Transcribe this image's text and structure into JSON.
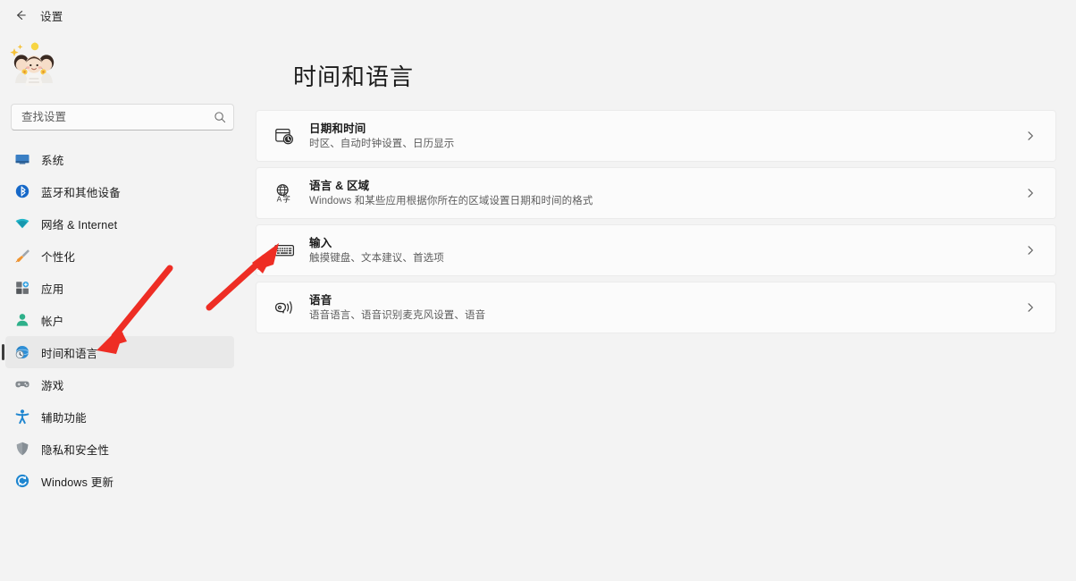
{
  "window": {
    "title": "设置",
    "back_icon": "back-arrow-icon"
  },
  "sidebar": {
    "avatar": "user-avatar",
    "search": {
      "placeholder": "查找设置",
      "value": "",
      "icon": "search-icon"
    },
    "items": [
      {
        "label": "系统",
        "icon": "monitor-icon",
        "selected": false
      },
      {
        "label": "蓝牙和其他设备",
        "icon": "bluetooth-icon",
        "selected": false
      },
      {
        "label": "网络 & Internet",
        "icon": "wifi-icon",
        "selected": false
      },
      {
        "label": "个性化",
        "icon": "paintbrush-icon",
        "selected": false
      },
      {
        "label": "应用",
        "icon": "apps-icon",
        "selected": false
      },
      {
        "label": "帐户",
        "icon": "person-icon",
        "selected": false
      },
      {
        "label": "时间和语言",
        "icon": "clock-globe-icon",
        "selected": true
      },
      {
        "label": "游戏",
        "icon": "gamepad-icon",
        "selected": false
      },
      {
        "label": "辅助功能",
        "icon": "accessibility-icon",
        "selected": false
      },
      {
        "label": "隐私和安全性",
        "icon": "shield-icon",
        "selected": false
      },
      {
        "label": "Windows 更新",
        "icon": "update-icon",
        "selected": false
      }
    ]
  },
  "main": {
    "page_title": "时间和语言",
    "cards": [
      {
        "title": "日期和时间",
        "subtitle": "时区、自动时钟设置、日历显示",
        "icon": "calendar-clock-icon",
        "chevron": "chevron-right-icon"
      },
      {
        "title": "语言 & 区域",
        "subtitle": "Windows 和某些应用根据你所在的区域设置日期和时间的格式",
        "icon": "language-region-icon",
        "chevron": "chevron-right-icon"
      },
      {
        "title": "输入",
        "subtitle": "触摸键盘、文本建议、首选项",
        "icon": "keyboard-icon",
        "chevron": "chevron-right-icon"
      },
      {
        "title": "语音",
        "subtitle": "语音语言、语音识别麦克风设置、语音",
        "icon": "speech-icon",
        "chevron": "chevron-right-icon"
      }
    ]
  },
  "annotations": {
    "color": "#ee2d24",
    "arrows": [
      {
        "name": "arrow-to-time-and-language",
        "target": "时间和语言"
      },
      {
        "name": "arrow-to-input-card",
        "target": "输入"
      }
    ]
  },
  "colors": {
    "background": "#f3f3f3",
    "card": "#fbfbfb",
    "selected_nav": "#e9e9e9",
    "accent_bar": "#3d3d3d",
    "annotation_red": "#ee2d24"
  }
}
